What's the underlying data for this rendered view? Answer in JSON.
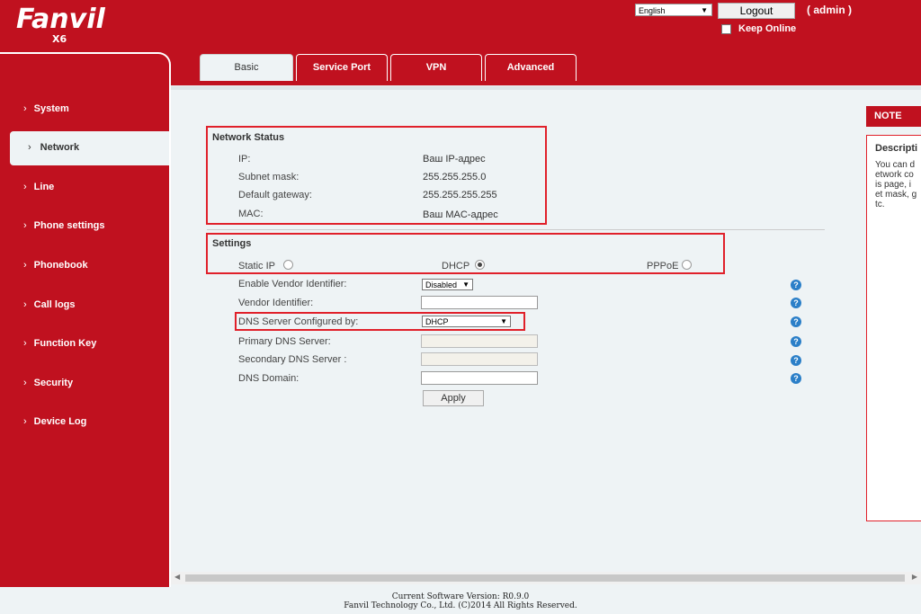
{
  "brand": {
    "logo": "Fanvil",
    "model": "X6"
  },
  "header": {
    "language": "English",
    "logout_label": "Logout",
    "user": "( admin )",
    "keep_online_label": "Keep Online"
  },
  "tabs": [
    {
      "label": "Basic",
      "active": true
    },
    {
      "label": "Service Port"
    },
    {
      "label": "VPN"
    },
    {
      "label": "Advanced"
    }
  ],
  "sidebar": {
    "items": [
      {
        "label": "System"
      },
      {
        "label": "Network",
        "active": true
      },
      {
        "label": "Line"
      },
      {
        "label": "Phone settings"
      },
      {
        "label": "Phonebook"
      },
      {
        "label": "Call logs"
      },
      {
        "label": "Function Key"
      },
      {
        "label": "Security"
      },
      {
        "label": "Device Log"
      }
    ]
  },
  "network_status": {
    "title": "Network Status",
    "rows": [
      {
        "label": "IP:",
        "value": "Ваш IP-адрес"
      },
      {
        "label": "Subnet mask:",
        "value": "255.255.255.0"
      },
      {
        "label": "Default gateway:",
        "value": "255.255.255.255"
      },
      {
        "label": "MAC:",
        "value": "Ваш MAC-адрес"
      }
    ]
  },
  "settings": {
    "title": "Settings",
    "mode": {
      "static_ip": "Static IP",
      "dhcp": "DHCP",
      "pppoe": "PPPoE",
      "selected": "DHCP"
    },
    "vendor_enable_label": "Enable Vendor Identifier:",
    "vendor_enable_value": "Disabled",
    "vendor_id_label": "Vendor Identifier:",
    "vendor_id_value": "",
    "dns_config_label": "DNS Server Configured by:",
    "dns_config_value": "DHCP",
    "primary_dns_label": "Primary DNS Server:",
    "primary_dns_value": "",
    "secondary_dns_label": "Secondary DNS Server :",
    "secondary_dns_value": "",
    "dns_domain_label": "DNS Domain:",
    "dns_domain_value": "",
    "apply_label": "Apply"
  },
  "note": {
    "header": "NOTE",
    "title": "Descripti",
    "lines": [
      "You can d",
      "etwork co",
      "is page, i",
      "et mask, g",
      "tc."
    ]
  },
  "footer": {
    "version": "Current Software Version: R0.9.0",
    "copyright": "Fanvil Technology Co., Ltd. (C)2014 All Rights Reserved."
  },
  "colors": {
    "brand_red": "#c0111f",
    "highlight_red": "#e0202a",
    "help_blue": "#2b7fc8"
  }
}
